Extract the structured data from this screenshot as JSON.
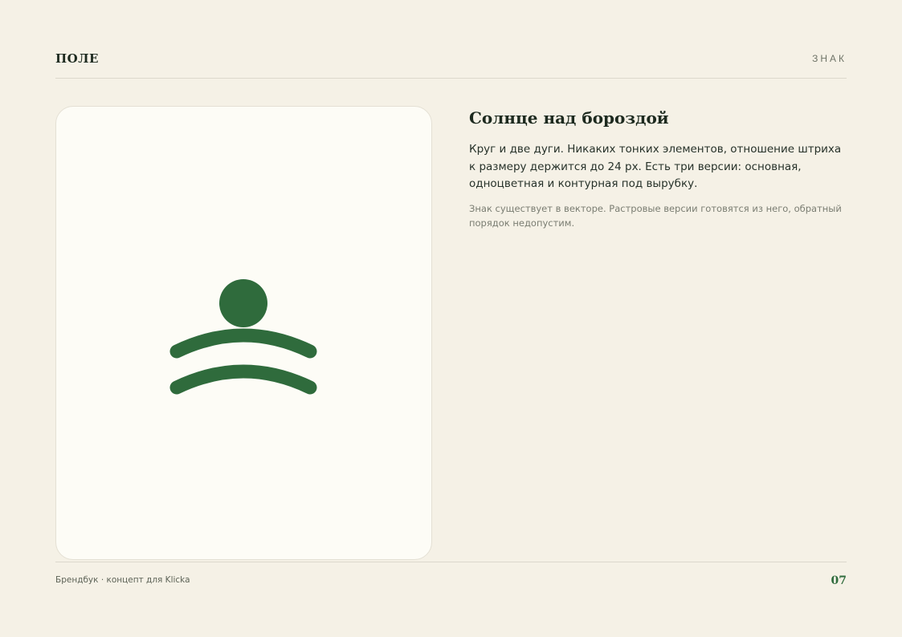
{
  "header": {
    "brand": "ПОЛЕ",
    "section": "ЗНАК"
  },
  "mark": {
    "icon": "sun-over-furrow-logo",
    "color": "#2f6b3c"
  },
  "content": {
    "title": "Солнце над бороздой",
    "lead": "Круг и две дуги. Никаких тонких элементов, отношение штриха к размеру держится до 24 px. Есть три версии: основная, одноцветная и контурная под вырубку.",
    "note": "Знак существует в векторе. Растровые версии готовятся из него, обратный порядок недопустим."
  },
  "footer": {
    "text": "Брендбук · концепт для Klicka",
    "page": "07"
  }
}
